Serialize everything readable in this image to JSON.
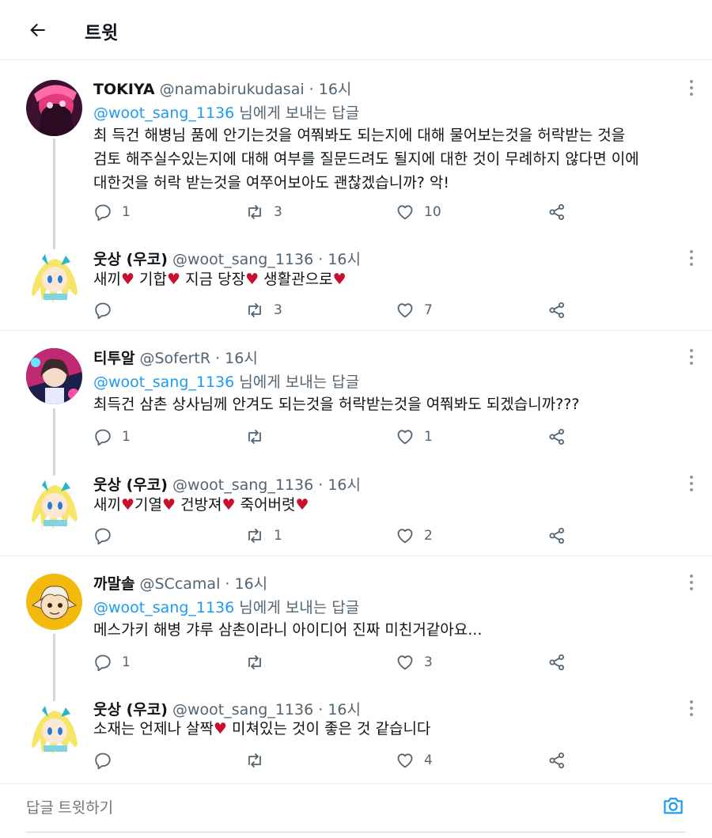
{
  "header": {
    "title": "트윗"
  },
  "composer": {
    "placeholder": "답글 트윗하기"
  },
  "colors": {
    "accent": "#1d9bf0",
    "heart": "#c8102e",
    "muted": "#536471"
  },
  "tweets": [
    {
      "name": "TOKIYA",
      "handle": "@namabirukudasai",
      "sep": " · ",
      "time": "16시",
      "reply_to": {
        "mention": "@woot_sang_1136",
        "suffix": " 님에게 보내는 답글"
      },
      "text": "최 득건 해병님 품에 안기는것을 여쭤봐도 되는지에 대해 물어보는것을 허락받는 것을\n검토 해주실수있는지에 대해 여부를 질문드려도 될지에 대한 것이 무례하지 않다면 이에\n대한것을 허락 받는것을 여쭈어보아도 괜찮겠습니까? 악!",
      "replies": "1",
      "retweets": "3",
      "likes": "10"
    },
    {
      "name": "웃상 (우코)",
      "handle": "@woot_sang_1136",
      "sep": " · ",
      "time": "16시",
      "segments": [
        "새끼",
        "♥",
        " 기합",
        "♥",
        " 지금 당장",
        "♥",
        " 생활관으로",
        "♥"
      ],
      "replies": "",
      "retweets": "3",
      "likes": "7"
    },
    {
      "name": "티투알",
      "handle": "@SofertR",
      "sep": " · ",
      "time": "16시",
      "reply_to": {
        "mention": "@woot_sang_1136",
        "suffix": " 님에게 보내는 답글"
      },
      "text": "최득건 삼촌 상사님께 안겨도 되는것을 허락받는것을 여쭤봐도 되겠습니까???",
      "replies": "1",
      "retweets": "",
      "likes": "1"
    },
    {
      "name": "웃상 (우코)",
      "handle": "@woot_sang_1136",
      "sep": " · ",
      "time": "16시",
      "segments": [
        "새끼",
        "♥",
        "기열",
        "♥",
        " 건방져",
        "♥",
        " 죽어버렷",
        "♥"
      ],
      "replies": "",
      "retweets": "1",
      "likes": "2"
    },
    {
      "name": "까말솔",
      "handle": "@SCcamal",
      "sep": " · ",
      "time": "16시",
      "reply_to": {
        "mention": "@woot_sang_1136",
        "suffix": " 님에게 보내는 답글"
      },
      "text": "메스가키 해병 갸루 삼촌이라니 아이디어 진짜 미친거같아요...",
      "replies": "1",
      "retweets": "",
      "likes": "3"
    },
    {
      "name": "웃상 (우코)",
      "handle": "@woot_sang_1136",
      "sep": " · ",
      "time": "16시",
      "segments": [
        "소재는 언제나 살짝",
        "♥",
        " 미쳐있는 것이 좋은 것 같습니다"
      ],
      "replies": "",
      "retweets": "",
      "likes": "4"
    }
  ]
}
